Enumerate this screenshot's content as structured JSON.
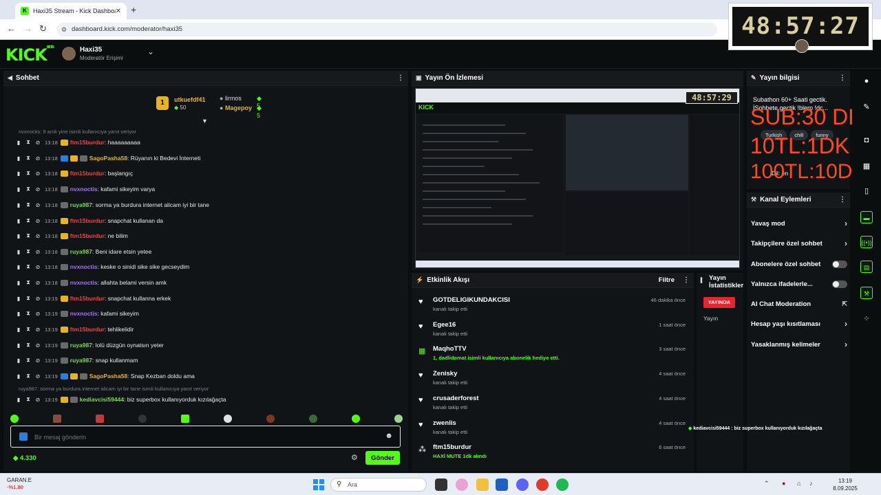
{
  "browser": {
    "tab_title": "Haxi35 Stream - Kick Dashboard",
    "url": "dashboard.kick.com/moderator/haxi35"
  },
  "timer": {
    "value": "48:57:27"
  },
  "header": {
    "logo": "KICK",
    "logo_beta": "BETA",
    "channel_name": "Haxi35",
    "channel_role": "Moderatör Erişimi"
  },
  "chat": {
    "title": "Sohbet",
    "leaderboard": {
      "first_user": "utkuefdf41",
      "first_count": "50",
      "second_user": "lirmos",
      "second_count": "5",
      "third_user": "Magepoy",
      "third_count": "5"
    },
    "reply_notes": [
      "nvxnoctis: 9 amk yine isimli kullanıcıya yanıt veriyor",
      "ruya987: sorma ya burdura internet alicam iyi bir tane isimli kullanıcıya yanıt veriyor"
    ],
    "messages": [
      {
        "time": "13:18",
        "user": "ftm15burdur",
        "text": ": haaaaaaaaa",
        "color": "#ff3b3b",
        "badge": "crown"
      },
      {
        "time": "13:18",
        "user": "SagoPasha58",
        "text": ": Rüyanın ki Bedevi İnterneti",
        "color": "#e6b422",
        "badge": "multi"
      },
      {
        "time": "13:18",
        "user": "ftm15burdur",
        "text": ": başlangıç",
        "color": "#ff3b3b",
        "badge": "crown"
      },
      {
        "time": "13:18",
        "user": "nvxnoctis",
        "text": ": kafami sikeyim varya",
        "color": "#a970ff",
        "badge": "gift"
      },
      {
        "time": "13:18",
        "user": "ruya987",
        "text": ": sorma ya burdura internet alicam iyi bir tane",
        "color": "#7ddc4f",
        "badge": "gift"
      },
      {
        "time": "13:18",
        "user": "ftm15burdur",
        "text": ": snapchat kullanan da",
        "color": "#ff3b3b",
        "badge": "crown"
      },
      {
        "time": "13:18",
        "user": "ftm15burdur",
        "text": ": ne bilim",
        "color": "#ff3b3b",
        "badge": "crown"
      },
      {
        "time": "13:18",
        "user": "ruya987",
        "text": ": Beni idare etsin yetee",
        "color": "#7ddc4f",
        "badge": "gift"
      },
      {
        "time": "13:18",
        "user": "nvxnoctis",
        "text": ": keske o sinidi sike sike gecseydim",
        "color": "#a970ff",
        "badge": "gift"
      },
      {
        "time": "13:18",
        "user": "nvxnoctis",
        "text": ": allahta belami versin amk",
        "color": "#a970ff",
        "badge": "gift"
      },
      {
        "time": "13:19",
        "user": "ftm15burdur",
        "text": ": snapchat kullanna erkek",
        "color": "#ff3b3b",
        "badge": "crown"
      },
      {
        "time": "13:19",
        "user": "nvxnoctis",
        "text": ": kafami sikeyim",
        "color": "#a970ff",
        "badge": "gift"
      },
      {
        "time": "13:19",
        "user": "ftm15burdur",
        "text": ": tehlikelidir",
        "color": "#ff3b3b",
        "badge": "crown"
      },
      {
        "time": "13:19",
        "user": "ruya987",
        "text": ": lolü düzgün oynatsın yeter",
        "color": "#7ddc4f",
        "badge": "gift"
      },
      {
        "time": "13:19",
        "user": "ruya987",
        "text": ": snap kullanmam",
        "color": "#7ddc4f",
        "badge": "gift"
      },
      {
        "time": "13:19",
        "user": "SagoPasha58",
        "text": ": Snap Kezban doldu ama",
        "color": "#e6b422",
        "badge": "multi"
      },
      {
        "time": "13:19",
        "user": "kediavcisi59444",
        "text": ": biz superbox kullanıyorduk kızılağaçta",
        "color": "#7ddc4f",
        "badge": "gold"
      }
    ],
    "input_placeholder": "Bir mesaj gönderin",
    "balance": "4.330",
    "send_label": "Gönder"
  },
  "preview": {
    "title": "Yayın Ön İzlemesi",
    "timer": "48:57:29"
  },
  "events": {
    "title": "Etkinlik Akışı",
    "filter_label": "Filtre",
    "items": [
      {
        "name": "GOTDELIGIKUNDAKCISI",
        "detail": "kanalı takip etti",
        "time": "46 dakika önce",
        "icon": "heart",
        "green": false
      },
      {
        "name": "Egee16",
        "detail": "kanalı takip etti",
        "time": "1 saat önce",
        "icon": "heart",
        "green": false
      },
      {
        "name": "MaqhoTTV",
        "detail": "1, dadlidomat isimli kullanıcıya abonelik hediye etti.",
        "time": "3 saat önce",
        "icon": "gift",
        "green": true
      },
      {
        "name": "Zenisky",
        "detail": "kanalı takip etti",
        "time": "4 saat önce",
        "icon": "heart",
        "green": false
      },
      {
        "name": "crusaderforest",
        "detail": "kanalı takip etti",
        "time": "4 saat önce",
        "icon": "heart",
        "green": false
      },
      {
        "name": "zwenlis",
        "detail": "kanalı takip etti",
        "time": "4 saat önce",
        "icon": "heart",
        "green": false
      },
      {
        "name": "ftm15burdur",
        "detail": "HAXİ MUTE 1dk alındı",
        "time": "6 saat önce",
        "icon": "reward",
        "green": true
      }
    ]
  },
  "stats": {
    "title_line1": "Yayın",
    "title_line2": "İstatistikler",
    "live_badge": "YAYINDA",
    "label": "Yayın"
  },
  "stream_info": {
    "title": "Yayın bilgisi",
    "description": "Subathon 60+ Saati gectik. İSohbete gectik !blerp !dc...",
    "tags": [
      "Turkish",
      "chill",
      "funny"
    ],
    "language": "Dil: en"
  },
  "overlay": {
    "line1": "SUB:30 DK",
    "line2": "10TL:1DK",
    "line3": "100TL:10DK"
  },
  "actions": {
    "title": "Kanal Eylemleri",
    "items": [
      {
        "label": "Yavaş mod",
        "kind": "chevron"
      },
      {
        "label": "Takipçilere özel sohbet",
        "kind": "chevron"
      },
      {
        "label": "Abonelere özel sohbet",
        "kind": "toggle"
      },
      {
        "label": "Yalnızca ifadelerle...",
        "kind": "toggle"
      },
      {
        "label": "AI Chat Moderation",
        "kind": "external"
      },
      {
        "label": "Hesap yaşı kısıtlaması",
        "kind": "chevron"
      },
      {
        "label": "Yasaklanmış kelimeler",
        "kind": "chevron"
      }
    ]
  },
  "ticker": {
    "text": "kediavcisi59444 : biz superbox kullanıyorduk kızılağaçta"
  },
  "taskbar": {
    "weather_name": "GARAN.E",
    "weather_value": "-%1,80",
    "search_placeholder": "Ara",
    "time": "13:19",
    "date": "8.09.2025"
  },
  "colors": {
    "accent": "#53fc18",
    "live": "#e8242f",
    "overlay": "#ff4a1e"
  }
}
